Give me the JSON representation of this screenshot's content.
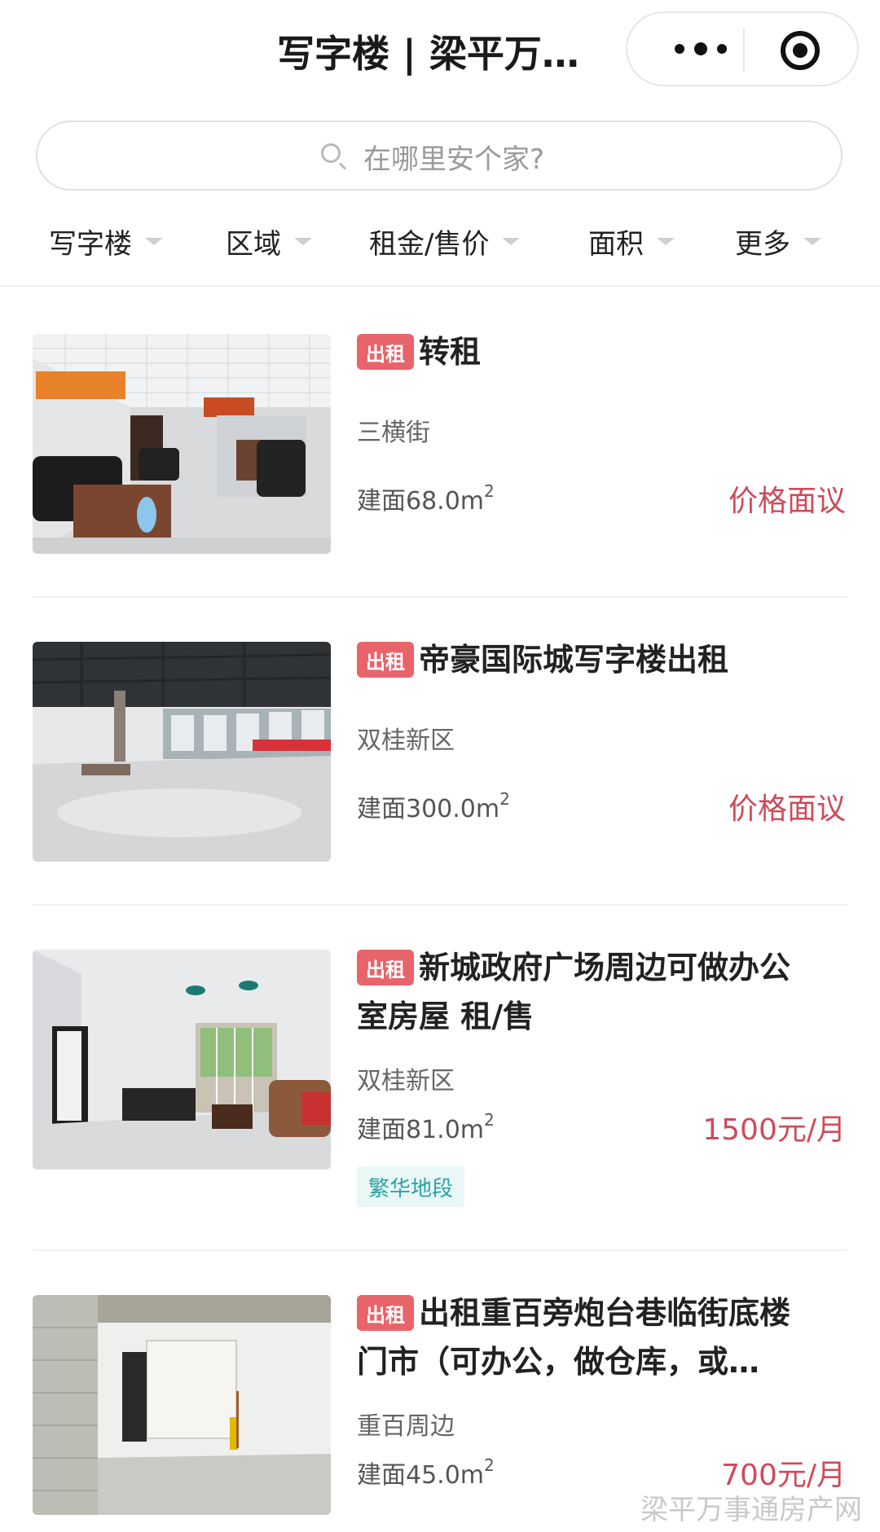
{
  "header": {
    "title": "写字楼 | 梁平万…"
  },
  "search": {
    "placeholder": "在哪里安个家?"
  },
  "filters": [
    {
      "label": "写字楼"
    },
    {
      "label": "区域"
    },
    {
      "label": "租金/售价"
    },
    {
      "label": "面积"
    },
    {
      "label": "更多"
    }
  ],
  "listings": [
    {
      "tag": "出租",
      "title_line1": "转租",
      "title_line2": "",
      "location": "三横街",
      "area_text": "建面68.0m",
      "area_sup": "2",
      "price": "价格面议",
      "badge": ""
    },
    {
      "tag": "出租",
      "title_line1": "帝豪国际城写字楼出租",
      "title_line2": "",
      "location": "双桂新区",
      "area_text": "建面300.0m",
      "area_sup": "2",
      "price": "价格面议",
      "badge": ""
    },
    {
      "tag": "出租",
      "title_line1": "新城政府广场周边可做办公",
      "title_line2": "室房屋 租/售",
      "location": "双桂新区",
      "area_text": "建面81.0m",
      "area_sup": "2",
      "price": "1500元/月",
      "badge": "繁华地段"
    },
    {
      "tag": "出租",
      "title_line1": "出租重百旁炮台巷临街底楼",
      "title_line2": "门市（可办公，做仓库，或…",
      "location": "重百周边",
      "area_text": "建面45.0m",
      "area_sup": "2",
      "price": "700元/月",
      "badge": ""
    }
  ],
  "watermark": "梁平万事通房产网"
}
